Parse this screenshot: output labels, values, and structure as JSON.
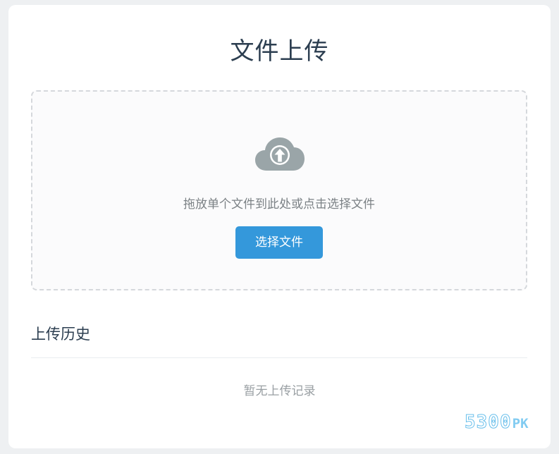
{
  "page": {
    "title": "文件上传"
  },
  "upload": {
    "icon": "cloud-upload-icon",
    "hint": "拖放单个文件到此处或点击选择文件",
    "select_button_label": "选择文件"
  },
  "history": {
    "title": "上传历史",
    "empty_text": "暂无上传记录"
  },
  "watermark": {
    "digits": "5300",
    "suffix": "PK"
  },
  "colors": {
    "accent": "#3498db",
    "title_text": "#2c3e50",
    "icon": "#9aa5a8",
    "dashed_border": "#d5d8dc",
    "muted_text": "#999fa3"
  }
}
